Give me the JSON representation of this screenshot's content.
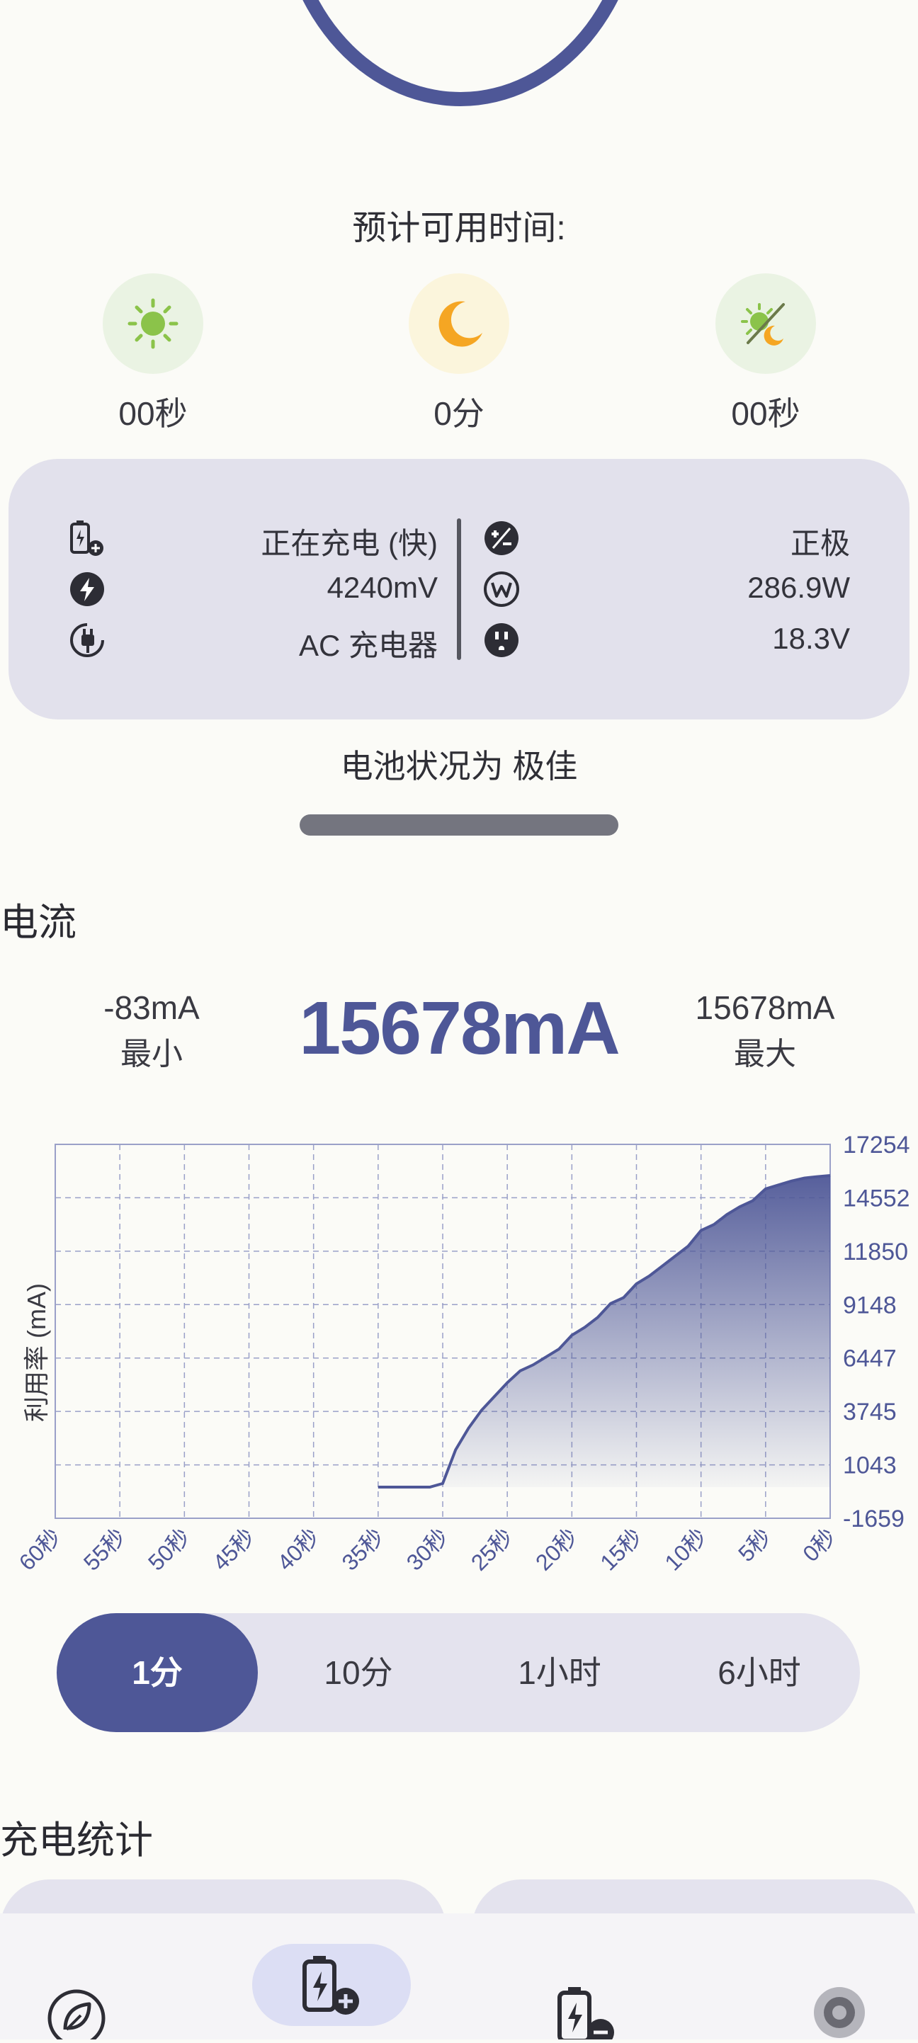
{
  "estimate": {
    "title": "预计可用时间:",
    "items": [
      {
        "icon": "sun-icon",
        "value": "00秒"
      },
      {
        "icon": "moon-icon",
        "value": "0分"
      },
      {
        "icon": "day-night-icon",
        "value": "00秒"
      }
    ]
  },
  "info": {
    "left": [
      {
        "icon": "battery-charging-icon",
        "text": "正在充电 (快)"
      },
      {
        "icon": "lightning-icon",
        "text": "4240mV"
      },
      {
        "icon": "plug-icon",
        "text": "AC 充电器"
      }
    ],
    "right": [
      {
        "icon": "polarity-icon",
        "text": "正极"
      },
      {
        "icon": "watt-icon",
        "text": "286.9W"
      },
      {
        "icon": "outlet-icon",
        "text": "18.3V"
      }
    ]
  },
  "health_text": "电池状况为 极佳",
  "current": {
    "title": "电流",
    "min_value": "-83mA",
    "min_label": "最小",
    "now_value": "15678mA",
    "max_value": "15678mA",
    "max_label": "最大"
  },
  "chart_data": {
    "type": "area",
    "ylabel": "利用率 (mA)",
    "x_ticks": [
      "60秒",
      "55秒",
      "50秒",
      "45秒",
      "40秒",
      "35秒",
      "30秒",
      "25秒",
      "20秒",
      "15秒",
      "10秒",
      "5秒",
      "0秒"
    ],
    "y_ticks": [
      "17254",
      "14552",
      "11850",
      "9148",
      "6447",
      "3745",
      "1043",
      "-1659"
    ],
    "ylim": [
      -1659,
      17254
    ],
    "grid": true,
    "series": [
      {
        "x": [
          -35,
          -31,
          -30,
          -29,
          -28,
          -27,
          -26,
          -25,
          -24,
          -23,
          -22,
          -21,
          -20,
          -19,
          -18,
          -17,
          -16,
          -15,
          -14,
          -13,
          -12,
          -11,
          -10,
          -9,
          -8,
          -7,
          -6,
          -5,
          -4,
          -3,
          -2,
          -1,
          0
        ],
        "values": [
          -83,
          -83,
          100,
          1800,
          2900,
          3800,
          4500,
          5200,
          5800,
          6100,
          6500,
          6900,
          7600,
          8000,
          8500,
          9200,
          9500,
          10200,
          10600,
          11100,
          11600,
          12100,
          12900,
          13200,
          13700,
          14100,
          14400,
          15000,
          15200,
          15400,
          15550,
          15620,
          15678
        ]
      }
    ],
    "color": "#4e5797"
  },
  "ranges": {
    "options": [
      "1分",
      "10分",
      "1小时",
      "6小时"
    ],
    "selected": "1分"
  },
  "stats_title": "充电统计"
}
